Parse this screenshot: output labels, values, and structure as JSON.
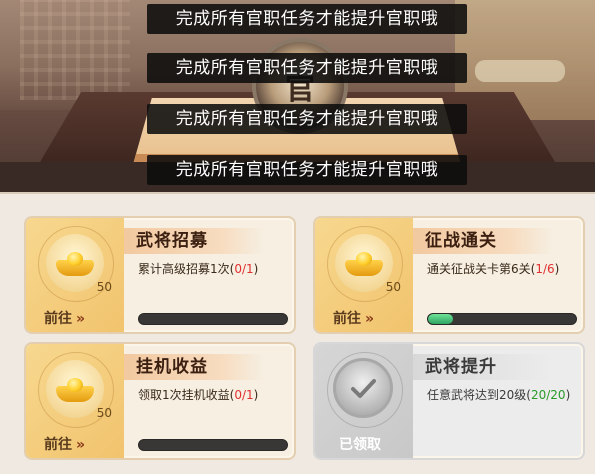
{
  "toasts": [
    "完成所有官职任务才能提升官职哦",
    "完成所有官职任务才能提升官职哦",
    "完成所有官职任务才能提升官职哦",
    "完成所有官职任务才能提升官职哦"
  ],
  "seal_glyph": "官",
  "tasks": [
    {
      "title": "武将招募",
      "desc": "累计高级招募1次",
      "progress_open": "(",
      "progress_value": "0/1",
      "progress_close": ")",
      "reward_count": "50",
      "goto_label": "前往",
      "goto_arrows": "»",
      "progress_fraction": 0
    },
    {
      "title": "征战通关",
      "desc": "通关征战关卡第6关",
      "progress_open": "(",
      "progress_value": "1/6",
      "progress_close": ")",
      "reward_count": "50",
      "goto_label": "前往",
      "goto_arrows": "»",
      "progress_fraction": 0.167
    },
    {
      "title": "挂机收益",
      "desc": "领取1次挂机收益",
      "progress_open": "(",
      "progress_value": "0/1",
      "progress_close": ")",
      "reward_count": "50",
      "goto_label": "前往",
      "goto_arrows": "»",
      "progress_fraction": 0
    },
    {
      "title": "武将提升",
      "desc": "任意武将达到20级",
      "progress_open": "(",
      "progress_value": "20/20",
      "progress_close": ")",
      "status_label": "已领取",
      "progress_fraction": 1
    }
  ],
  "colors": {
    "progress_incomplete": "#e23030",
    "progress_complete": "#2a9a2a",
    "bar_fill": "#2fa45f"
  }
}
